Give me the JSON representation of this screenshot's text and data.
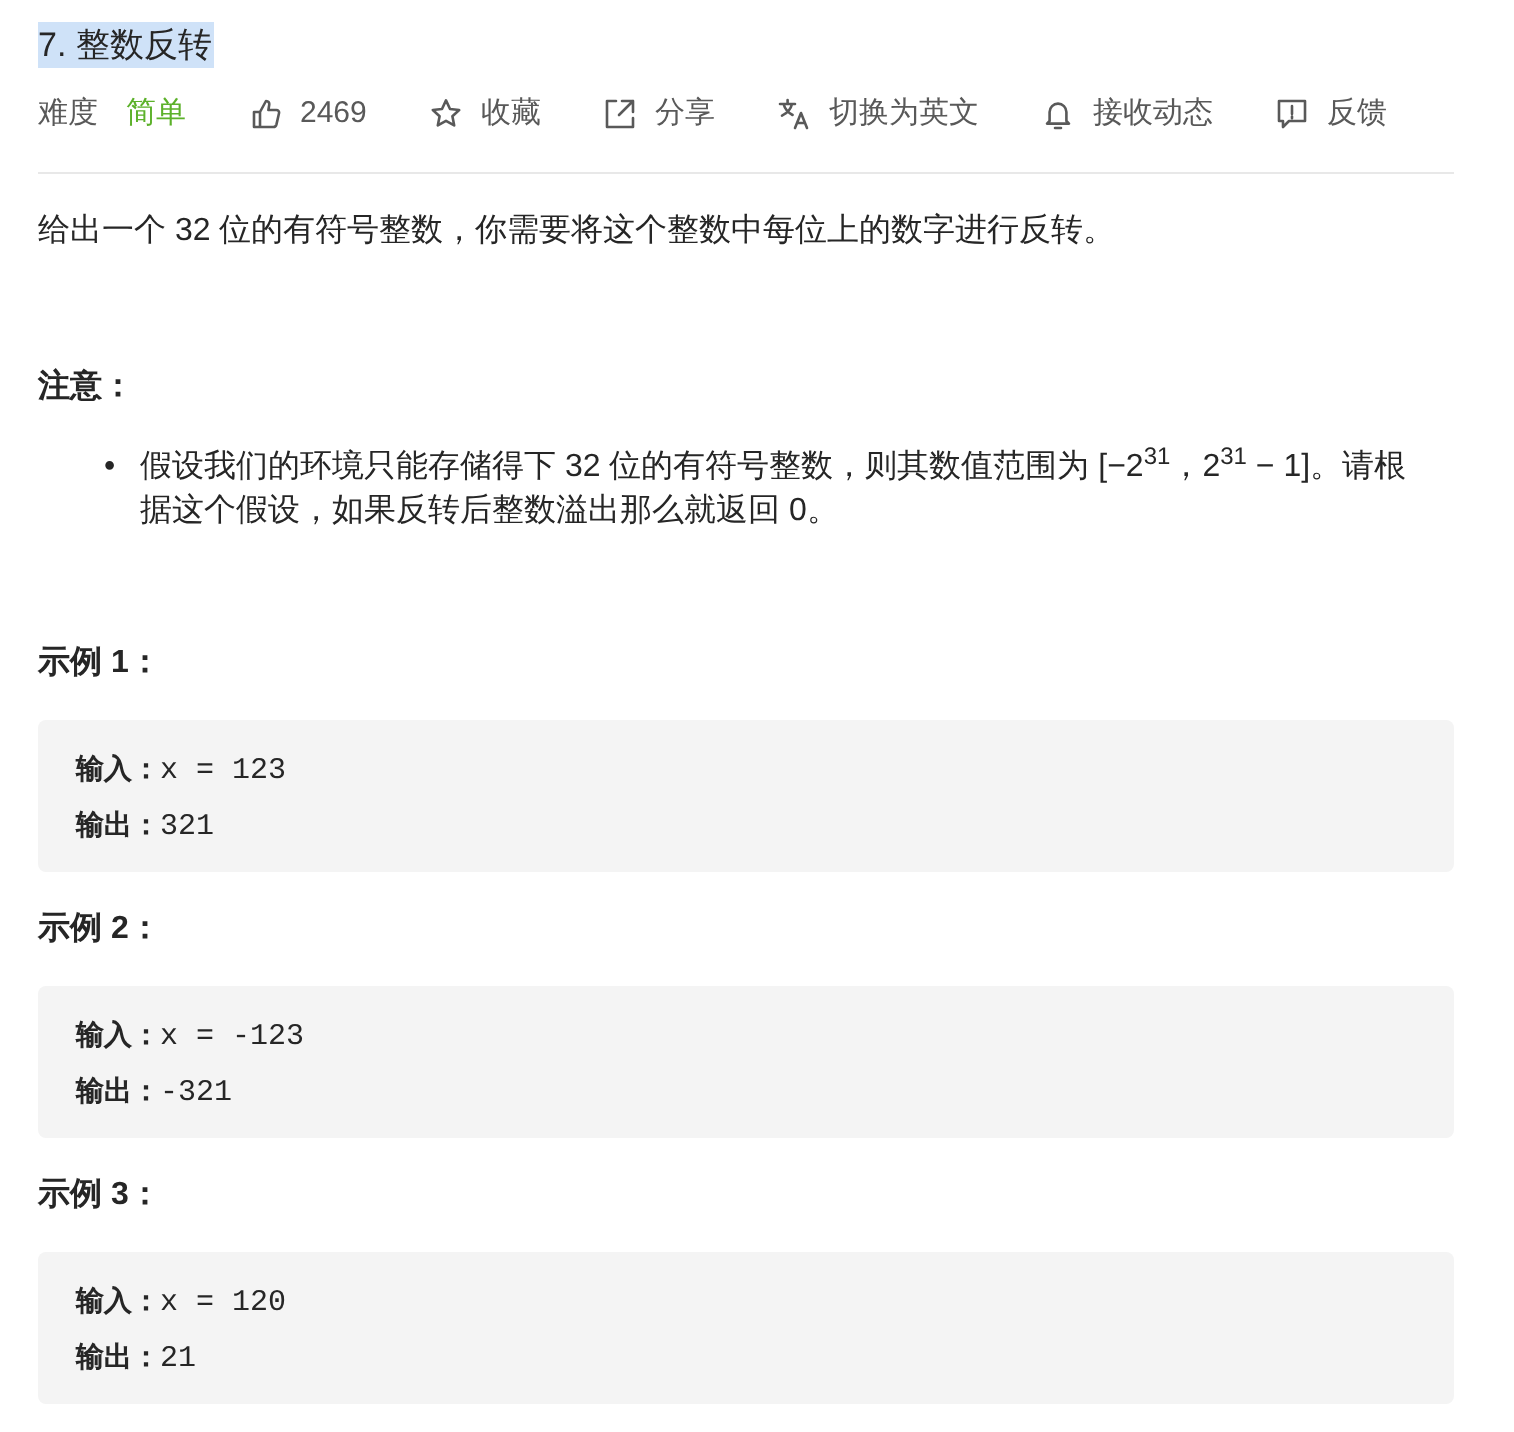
{
  "title": {
    "text": "7. 整数反转",
    "highlighted": true
  },
  "meta": {
    "difficulty_label": "难度",
    "difficulty": "简单",
    "actions": [
      {
        "kind": "like",
        "label": "2469"
      },
      {
        "kind": "favorite",
        "label": "收藏"
      },
      {
        "kind": "share",
        "label": "分享"
      },
      {
        "kind": "translate",
        "label": "切换为英文"
      },
      {
        "kind": "subscribe",
        "label": "接收动态"
      },
      {
        "kind": "feedback",
        "label": "反馈"
      }
    ]
  },
  "description": "给出一个 32 位的有符号整数，你需要将这个整数中每位上的数字进行反转。",
  "note": {
    "heading": "注意：",
    "items": [
      {
        "marker": "•",
        "text": "假设我们的环境只能存储得下 32 位的有符号整数，则其数值范围为 [−2$^{31}$，2$^{31}$ − 1]。请根据这个假设，如果反转后整数溢出那么就返回 0。"
      }
    ]
  },
  "examples": [
    {
      "heading": "示例 1：",
      "lines": [
        "**输入：**x = 123",
        "**输出：**321"
      ]
    },
    {
      "heading": "示例 2：",
      "lines": [
        "**输入：**x = -123",
        "**输出：**-321"
      ]
    },
    {
      "heading": "示例 3：",
      "lines": [
        "**输入：**x = 120",
        "**输出：**21"
      ]
    }
  ]
}
